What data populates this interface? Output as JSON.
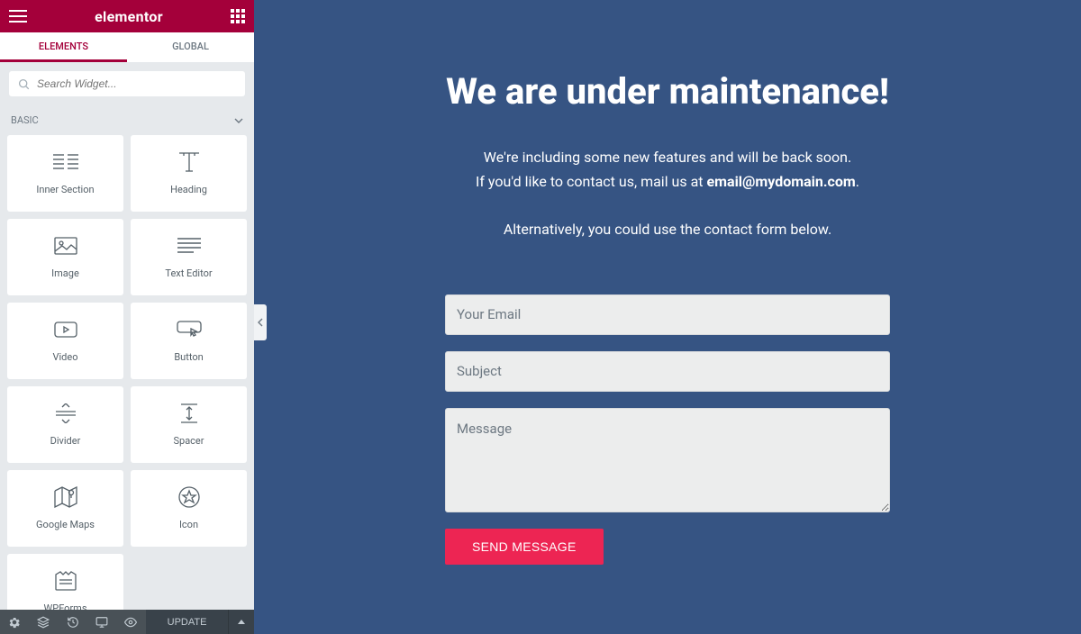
{
  "header": {
    "logo": "elementor"
  },
  "tabs": {
    "elements": "ELEMENTS",
    "global": "GLOBAL"
  },
  "search": {
    "placeholder": "Search Widget..."
  },
  "section": {
    "basic": "BASIC"
  },
  "widgets": [
    {
      "id": "inner-section",
      "label": "Inner Section"
    },
    {
      "id": "heading",
      "label": "Heading"
    },
    {
      "id": "image",
      "label": "Image"
    },
    {
      "id": "text-editor",
      "label": "Text Editor"
    },
    {
      "id": "video",
      "label": "Video"
    },
    {
      "id": "button",
      "label": "Button"
    },
    {
      "id": "divider",
      "label": "Divider"
    },
    {
      "id": "spacer",
      "label": "Spacer"
    },
    {
      "id": "google-maps",
      "label": "Google Maps"
    },
    {
      "id": "icon",
      "label": "Icon"
    },
    {
      "id": "wpforms",
      "label": "WPForms"
    }
  ],
  "footer": {
    "update": "UPDATE"
  },
  "page": {
    "title": "We are under maintenance!",
    "line1": "We're including some new features and will be back soon.",
    "line2_pre": "If you'd like to contact us, mail us at ",
    "email": "email@mydomain.com",
    "line2_post": ".",
    "line3": "Alternatively, you could use the contact form below.",
    "form": {
      "email_ph": "Your Email",
      "subject_ph": "Subject",
      "message_ph": "Message",
      "submit": "SEND MESSAGE"
    }
  }
}
